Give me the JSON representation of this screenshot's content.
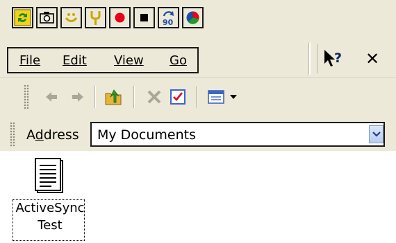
{
  "top_toolbar": {
    "icons": [
      "activesync-icon",
      "camera-icon",
      "smiley-icon",
      "tools-icon",
      "record-icon",
      "stop-icon",
      "rotate-90-icon",
      "pie-chart-icon"
    ]
  },
  "menu": {
    "file": "File",
    "edit": "Edit",
    "view": "View",
    "go": "Go",
    "help_icon": "whats-this-help-icon",
    "close_label": "✕"
  },
  "nav_toolbar": {
    "icons": [
      "back-arrow-icon",
      "forward-arrow-icon",
      "up-folder-icon",
      "delete-icon",
      "properties-icon",
      "view-menu-icon"
    ]
  },
  "address": {
    "label_prefix": "A",
    "label_underlined": "d",
    "label_suffix": "dress",
    "value": "My Documents"
  },
  "files": [
    {
      "icon": "document-icon",
      "line1": "ActiveSync",
      "line2": "Test"
    }
  ],
  "colors": {
    "toolbar_bg": "#ece9d8",
    "record_red": "#e8001c",
    "help_blue": "#0a246a"
  }
}
